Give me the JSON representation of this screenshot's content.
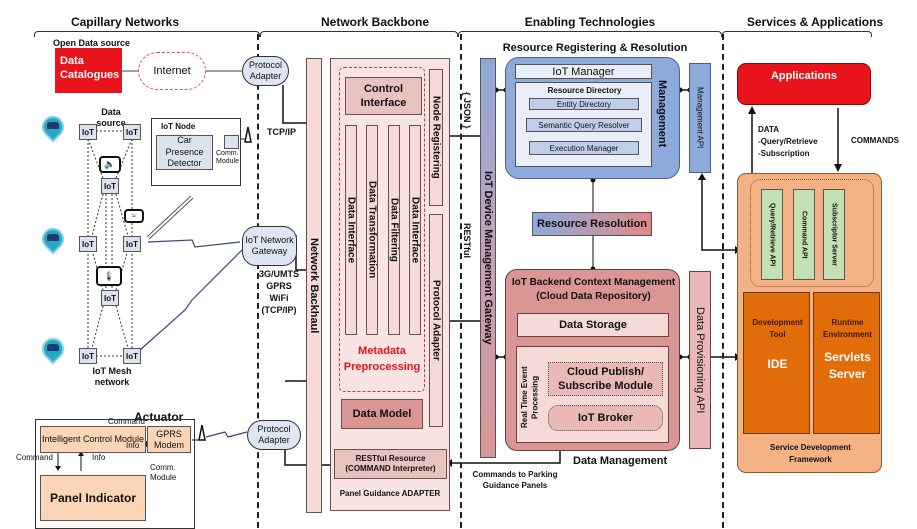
{
  "sections": {
    "capillary": "Capillary Networks",
    "backbone": "Network Backbone",
    "enabling": "Enabling Technologies",
    "services": "Services & Applications"
  },
  "capillary": {
    "open_data_label": "Open Data source",
    "data_catalogues": "Data Catalogues",
    "internet": "Internet",
    "data_source_label": "Data source",
    "iot_node_label": "IoT Node",
    "car_presence_detector": "Car Presence Detector",
    "comm_module": "Comm. Module",
    "iot_label": "IoT",
    "mesh_label": "IoT Mesh network",
    "tcp_ip": "TCP/IP",
    "protocol_adapter": "Protocol Adapter",
    "gateway": "IoT Network Gateway",
    "gateway_protocols": [
      "3G/UMTS",
      "GPRS",
      "WiFi",
      "(TCP/IP)"
    ],
    "actuator": {
      "title": "Actuator",
      "intelligent_control": "Intelligent Control Module",
      "gprs_modem": "GPRS Modem",
      "command_top": "Command",
      "info_mid": "Info",
      "command_left": "Command",
      "info_left": "Info",
      "comm_module": "Comm. Module",
      "panel_indicator": "Panel Indicator"
    }
  },
  "backbone": {
    "network_backhaul": "Network Backhaul",
    "control_interface": "Control Interface",
    "columns": [
      "Data Interface",
      "Data Transformation",
      "Data Filtering",
      "Data Interface"
    ],
    "metadata_preprocessing": "Metadata Preprocessing",
    "node_registering": "Node Registering",
    "protocol_adapter": "Protocol Adapter",
    "data_model": "Data Model",
    "restful_resource": "RESTful Resource (COMMAND Interpreter)",
    "panel_guidance": "Panel Guidance ADAPTER",
    "json_label": "{ JSON }",
    "restful_label": "RESTful"
  },
  "enabling": {
    "rrr_title": "Resource Registering & Resolution",
    "iot_manager": "IoT Manager",
    "resource_directory": "Resource Directory",
    "entity_directory": "Entity Directory",
    "semantic_query_resolver": "Semantic Query Resolver",
    "execution_manager": "Execution Manager",
    "management": "Management",
    "management_api": "Management API",
    "gateway": "IoT Device Management Gateway",
    "resource_resolution": "Resource Resolution",
    "backend_title": "IoT Backend Context Management (Cloud Data Repository)",
    "data_storage": "Data Storage",
    "real_time": "Real Time Event Processing",
    "cloud_pubsub": "Cloud Publish/ Subscribe Module",
    "iot_broker": "IoT Broker",
    "data_provisioning_api": "Data Provisioning API",
    "data_management": "Data Management",
    "commands_to_panels": "Commands to Parking Guidance Panels"
  },
  "services": {
    "applications": "Applications",
    "data_label": "DATA",
    "query_retrieve": "-Query/Retrieve",
    "subscription": "-Subscription",
    "commands": "COMMANDS",
    "apis": [
      "Query/Retrieve API",
      "Command API",
      "Subscriptor Server"
    ],
    "development_tool": "Development Tool",
    "ide": "IDE",
    "runtime_env": "Runtime Environment",
    "servlets_server": "Servlets Server",
    "framework": "Service Development Framework"
  },
  "colors": {
    "red": "#e8131b",
    "blue": "#8eaadb",
    "pink": "#f5dad8",
    "rose": "#d99694",
    "orange": "#f4b183",
    "dark_orange": "#e36c0a",
    "green": "#c5dfb4"
  }
}
